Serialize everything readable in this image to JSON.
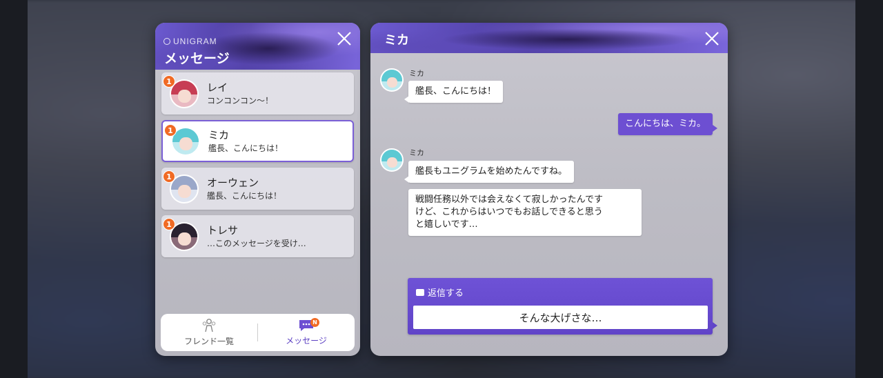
{
  "list_panel": {
    "brand": "UNIGRAM",
    "title": "メッセージ",
    "contacts": [
      {
        "name": "レイ",
        "preview": "コンコンコン〜！",
        "unread": "1",
        "hair": "#c73d54"
      },
      {
        "name": "ミカ",
        "preview": "艦長、こんにちは！",
        "unread": "1",
        "hair": "#5cc9d3"
      },
      {
        "name": "オーウェン",
        "preview": "艦長、こんにちは！",
        "unread": "1",
        "hair": "#9aa7c9"
      },
      {
        "name": "トレサ",
        "preview": "…このメッセージを受け…",
        "unread": "1",
        "hair": "#2a2230"
      }
    ],
    "nav": {
      "friends_label": "フレンド一覧",
      "messages_label": "メッセージ",
      "messages_badge": "N"
    }
  },
  "chat_panel": {
    "title": "ミカ",
    "messages": [
      {
        "sender": "ミカ",
        "text": "艦長、こんにちは！"
      },
      {
        "text": "こんにちは、ミカ。"
      },
      {
        "sender": "ミカ",
        "text": "艦長もユニグラムを始めたんですね。"
      },
      {
        "text_lines": [
          "戦闘任務以外では会えなくて寂しかったんです",
          "けど、これからはいつでもお話しできると思う",
          "と嬉しいです…"
        ]
      }
    ],
    "reply": {
      "header": "返信する",
      "option": "そんな大げさな…"
    }
  },
  "colors": {
    "accent": "#6d4fd2",
    "badge": "#f06a24",
    "selected_border": "#7a5fd6"
  }
}
